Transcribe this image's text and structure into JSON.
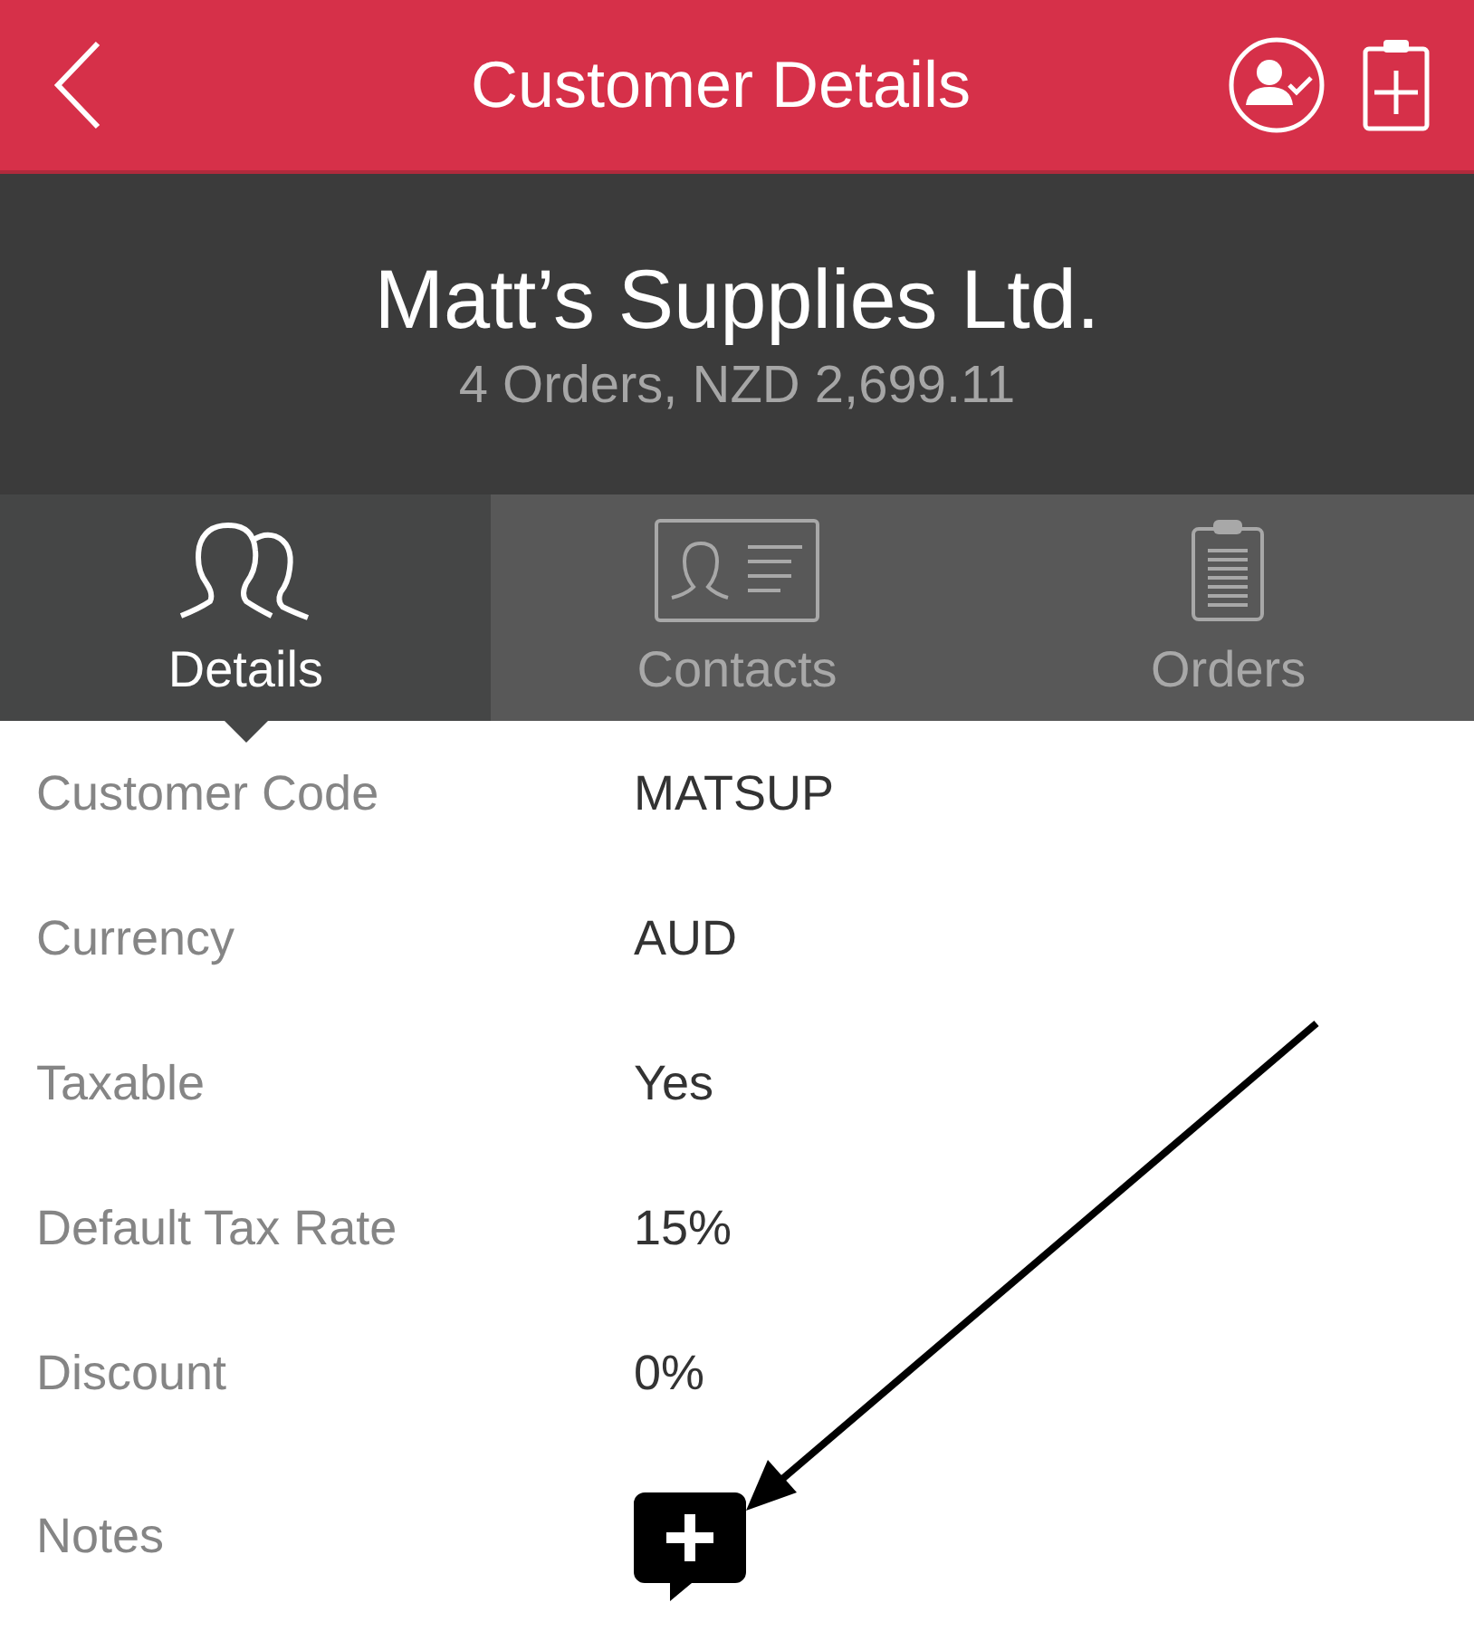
{
  "header": {
    "title": "Customer Details"
  },
  "customer": {
    "name": "Matt’s Supplies Ltd.",
    "summary": "4 Orders, NZD 2,699.11"
  },
  "tabs": [
    {
      "label": "Details",
      "kind": "people",
      "selected": true
    },
    {
      "label": "Contacts",
      "kind": "contact-card",
      "selected": false
    },
    {
      "label": "Orders",
      "kind": "clipboard",
      "selected": false
    }
  ],
  "fields": [
    {
      "kind": "text",
      "label": "Customer Code",
      "value": "MATSUP"
    },
    {
      "kind": "text",
      "label": "Currency",
      "value": "AUD"
    },
    {
      "kind": "text",
      "label": "Taxable",
      "value": "Yes"
    },
    {
      "kind": "text",
      "label": "Default Tax Rate",
      "value": "15%"
    },
    {
      "kind": "text",
      "label": "Discount",
      "value": "0%"
    },
    {
      "kind": "add-note",
      "label": "Notes"
    }
  ]
}
